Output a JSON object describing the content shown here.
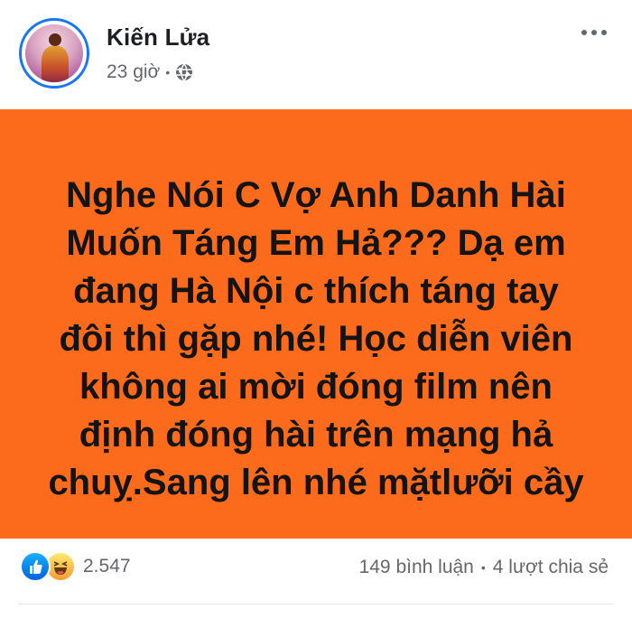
{
  "post": {
    "author": "Kiến Lửa",
    "time": "23 giờ",
    "meta_separator": "•",
    "privacy_icon": "globe-icon",
    "more_icon": "more-horizontal-icon"
  },
  "content": {
    "background_color": "#fc6a1b",
    "text": "Nghe Nói C Vợ Anh Danh Hài\nMuốn Táng Em Hả??? Dạ em\nđang Hà Nội c thích táng tay\nđôi thì gặp nhé! Học diễn viên\nkhông ai mời đóng film  nên\nđịnh đóng hài trên mạng hả\nchuỵ.Sang lên nhé mặtlưỡi cầy"
  },
  "footer": {
    "reaction_icons": [
      "like-icon",
      "haha-icon"
    ],
    "reaction_count": "2.547",
    "comments": "149 bình luận",
    "stats_separator": "•",
    "shares": "4 lượt chia sẻ"
  },
  "colors": {
    "accent": "#1877f2",
    "text_primary": "#1c1e21",
    "text_secondary": "#65676b"
  }
}
